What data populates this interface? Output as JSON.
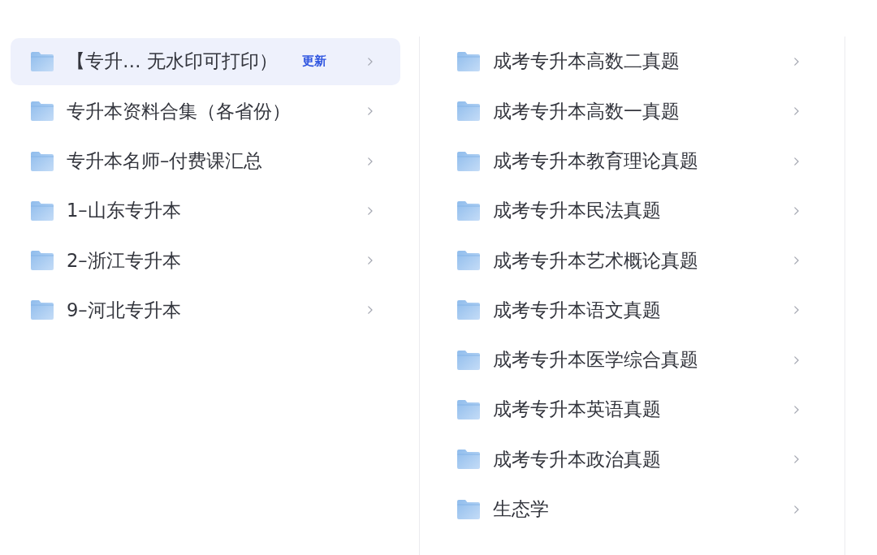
{
  "left_panel": {
    "items": [
      {
        "name": "【专升… 无水印可打印）",
        "badge": "更新",
        "selected": true
      },
      {
        "name": "专升本资料合集（各省份）",
        "selected": false
      },
      {
        "name": "专升本名师–付费课汇总",
        "selected": false
      },
      {
        "name": "1–山东专升本",
        "selected": false
      },
      {
        "name": "2–浙江专升本",
        "selected": false
      },
      {
        "name": "9–河北专升本",
        "selected": false
      }
    ]
  },
  "right_panel": {
    "items": [
      {
        "name": "成考专升本高数二真题",
        "selected": false
      },
      {
        "name": "成考专升本高数一真题",
        "selected": false
      },
      {
        "name": "成考专升本教育理论真题",
        "selected": false
      },
      {
        "name": "成考专升本民法真题",
        "selected": false
      },
      {
        "name": "成考专升本艺术概论真题",
        "selected": false
      },
      {
        "name": "成考专升本语文真题",
        "selected": false
      },
      {
        "name": "成考专升本医学综合真题",
        "selected": false
      },
      {
        "name": "成考专升本英语真题",
        "selected": false
      },
      {
        "name": "成考专升本政治真题",
        "selected": false
      },
      {
        "name": "生态学",
        "selected": false
      }
    ]
  }
}
